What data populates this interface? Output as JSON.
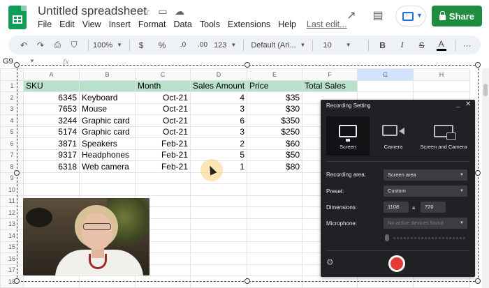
{
  "header": {
    "doc_title": "Untitled spreadsheet",
    "menu": [
      "File",
      "Edit",
      "View",
      "Insert",
      "Format",
      "Data",
      "Tools",
      "Extensions",
      "Help"
    ],
    "last_edit": "Last edit...",
    "share_label": "Share"
  },
  "toolbar": {
    "zoom": "100%",
    "currency": "$",
    "percent": "%",
    "dec_decrease": ".0",
    "dec_increase": ".00",
    "more_formats": "123",
    "font": "Default (Ari...",
    "font_size": "10",
    "bold": "B",
    "italic": "I",
    "strike": "S",
    "text_color": "A",
    "more": "···"
  },
  "formula_bar": {
    "cell_ref": "G9",
    "fx": "fx"
  },
  "sheet": {
    "columns": [
      "A",
      "B",
      "C",
      "D",
      "E",
      "F",
      "G",
      "H"
    ],
    "selected_column": "G",
    "row_numbers": [
      "1",
      "2",
      "3",
      "4",
      "5",
      "6",
      "7",
      "8",
      "9",
      "10",
      "11",
      "12",
      "13",
      "14",
      "15",
      "16",
      "17",
      "18"
    ],
    "header_row": [
      "SKU",
      "",
      "Month",
      "Sales Amount",
      "Price",
      "Total Sales",
      "",
      ""
    ],
    "rows": [
      [
        "6345",
        "Keyboard",
        "Oct-21",
        "4",
        "$35"
      ],
      [
        "7653",
        "Mouse",
        "Oct-21",
        "3",
        "$30"
      ],
      [
        "3244",
        "Graphic card",
        "Oct-21",
        "6",
        "$350"
      ],
      [
        "5174",
        "Graphic card",
        "Oct-21",
        "3",
        "$250"
      ],
      [
        "3871",
        "Speakers",
        "Feb-21",
        "2",
        "$60"
      ],
      [
        "9317",
        "Headphones",
        "Feb-21",
        "5",
        "$50"
      ],
      [
        "6318",
        "Web camera",
        "Feb-21",
        "1",
        "$80"
      ]
    ]
  },
  "recording_panel": {
    "title": "Recording Setting",
    "minimize": "_",
    "close": "✕",
    "tabs": [
      {
        "label": "Screen",
        "active": true
      },
      {
        "label": "Camera",
        "active": false
      },
      {
        "label": "Screen and Camera",
        "active": false
      }
    ],
    "recording_area_label": "Recording area:",
    "recording_area_value": "Screen area",
    "preset_label": "Preset:",
    "preset_value": "Custom",
    "dimensions_label": "Dimensions:",
    "width_value": "1108",
    "height_value": "720",
    "microphone_label": "Microphone:",
    "microphone_value": "No active devices found"
  },
  "colors": {
    "header_row_bg": "#b7e1cd",
    "share_bg": "#1e8e3e",
    "panel_bg": "#202124",
    "record_red": "#e53935"
  }
}
